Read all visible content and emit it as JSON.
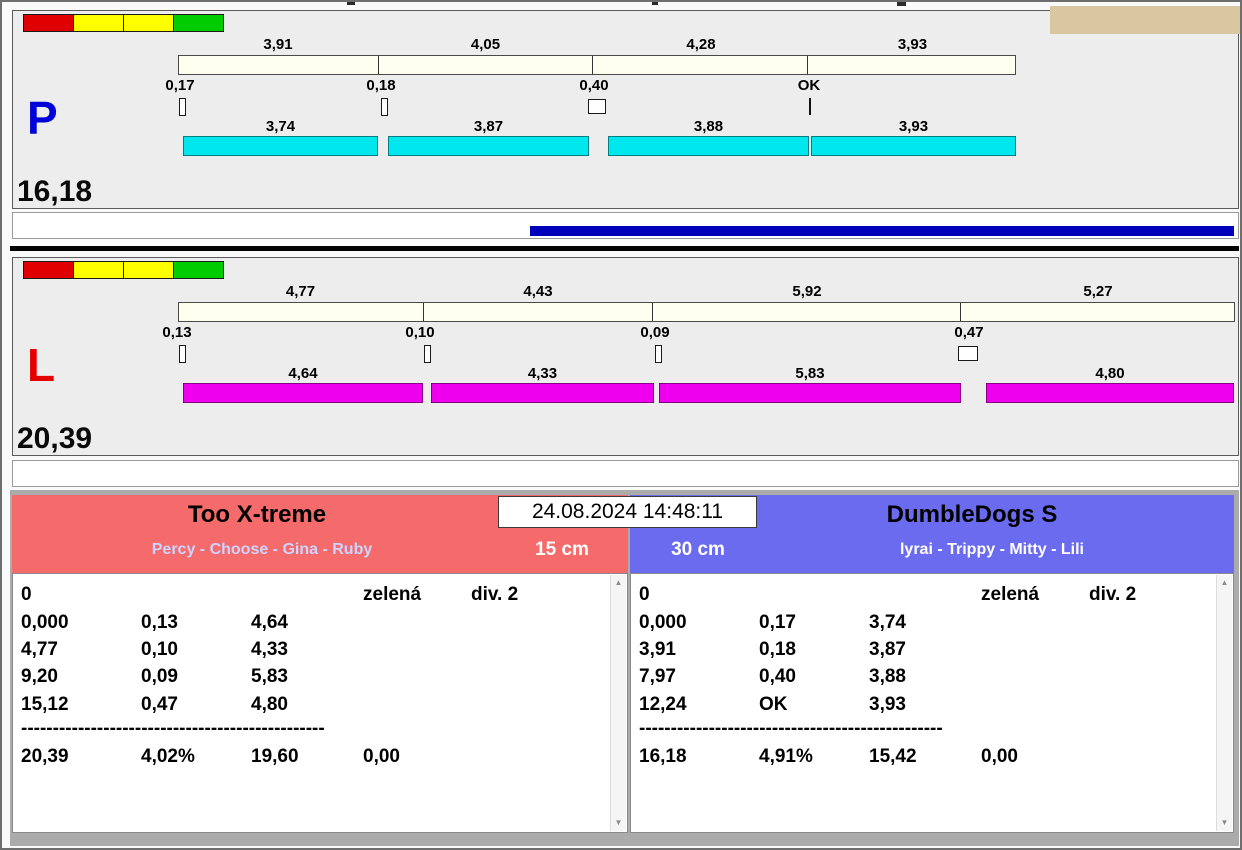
{
  "timestamp": "24.08.2024 14:48:11",
  "icons": {
    "scroll_up": "▲",
    "scroll_down": "▼"
  },
  "lanes": {
    "p": {
      "letter": "P",
      "total": "16,18",
      "top_splits": [
        "3,91",
        "4,05",
        "4,28",
        "3,93"
      ],
      "marks": [
        "0,17",
        "0,18",
        "0,40",
        "OK"
      ],
      "bottom_splits": [
        "3,74",
        "3,87",
        "3,88",
        "3,93"
      ]
    },
    "l": {
      "letter": "L",
      "total": "20,39",
      "top_splits": [
        "4,77",
        "4,43",
        "5,92",
        "5,27"
      ],
      "marks": [
        "0,13",
        "0,10",
        "0,09",
        "0,47"
      ],
      "bottom_splits": [
        "4,64",
        "4,33",
        "5,83",
        "4,80"
      ]
    }
  },
  "teams": {
    "left": {
      "name": "Too X-treme",
      "dogs": "Percy - Choose - Gina - Ruby",
      "jump_height": "15 cm",
      "table": {
        "run_number": "0",
        "status": "zelená",
        "division": "div. 2",
        "rows": [
          [
            "0,000",
            "0,13",
            "4,64"
          ],
          [
            "4,77",
            "0,10",
            "4,33"
          ],
          [
            "9,20",
            "0,09",
            "5,83"
          ],
          [
            "15,12",
            "0,47",
            "4,80"
          ]
        ],
        "separator": "------------------------------------------------",
        "totals": [
          "20,39",
          "4,02%",
          "19,60",
          "0,00"
        ]
      }
    },
    "right": {
      "name": "DumbleDogs S",
      "dogs": "lyrai - Trippy - Mitty - Lili",
      "jump_height": "30 cm",
      "table": {
        "run_number": "0",
        "status": "zelená",
        "division": "div. 2",
        "rows": [
          [
            "0,000",
            "0,17",
            "3,74"
          ],
          [
            "3,91",
            "0,18",
            "3,87"
          ],
          [
            "7,97",
            "0,40",
            "3,88"
          ],
          [
            "12,24",
            "OK",
            "3,93"
          ]
        ],
        "separator": "------------------------------------------------",
        "totals": [
          "16,18",
          "4,91%",
          "15,42",
          "0,00"
        ]
      }
    }
  },
  "colors": {
    "lights": [
      "#e00000",
      "#ffff00",
      "#ffff00",
      "#00cc00"
    ],
    "p_letter": "#0000d8",
    "l_letter": "#e40000",
    "p_bars": "#00e8ee",
    "l_bars": "#ee00ee",
    "split_track": "#fffff0",
    "progress_bar": "#0000bb",
    "left_header": "#f56a6a",
    "right_header": "#6b6bf0",
    "left_dogs_text": "#ccd4ff",
    "right_dogs_text": "#ffffff"
  }
}
